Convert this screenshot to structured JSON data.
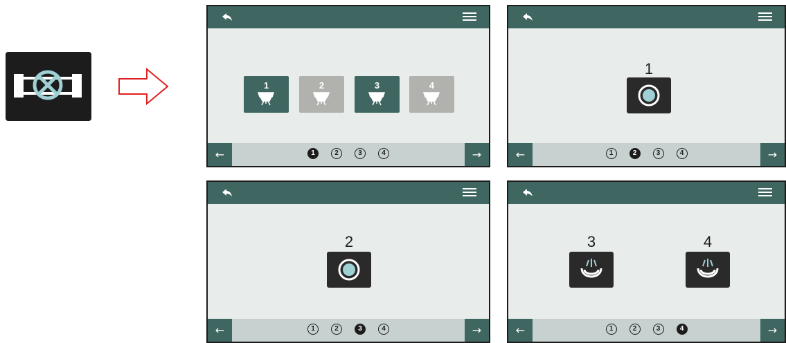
{
  "tile": {
    "icon": "valve-icon"
  },
  "arrow": {
    "icon": "right-arrow-outline"
  },
  "screens": [
    {
      "nozzles": [
        {
          "label": "1",
          "state": "active"
        },
        {
          "label": "2",
          "state": "inactive"
        },
        {
          "label": "3",
          "state": "active"
        },
        {
          "label": "4",
          "state": "inactive"
        }
      ],
      "pages": [
        "1",
        "2",
        "3",
        "4"
      ],
      "active_page": 1,
      "nav_left": "←",
      "nav_right": "→"
    },
    {
      "items": [
        {
          "label": "1",
          "icon": "ring-icon"
        }
      ],
      "pages": [
        "1",
        "2",
        "3",
        "4"
      ],
      "active_page": 2,
      "nav_left": "←",
      "nav_right": "→"
    },
    {
      "items": [
        {
          "label": "2",
          "icon": "ring-icon"
        }
      ],
      "pages": [
        "1",
        "2",
        "3",
        "4"
      ],
      "active_page": 3,
      "nav_left": "←",
      "nav_right": "→"
    },
    {
      "items": [
        {
          "label": "3",
          "icon": "spray-icon"
        },
        {
          "label": "4",
          "icon": "spray-icon"
        }
      ],
      "pages": [
        "1",
        "2",
        "3",
        "4"
      ],
      "active_page": 4,
      "nav_left": "←",
      "nav_right": "→"
    }
  ],
  "colors": {
    "header": "#3f6660",
    "background": "#e8ecea",
    "active_nozzle": "#3f6660",
    "inactive_nozzle": "#b1b2ad",
    "icon_ring": "#9fd0d3"
  }
}
